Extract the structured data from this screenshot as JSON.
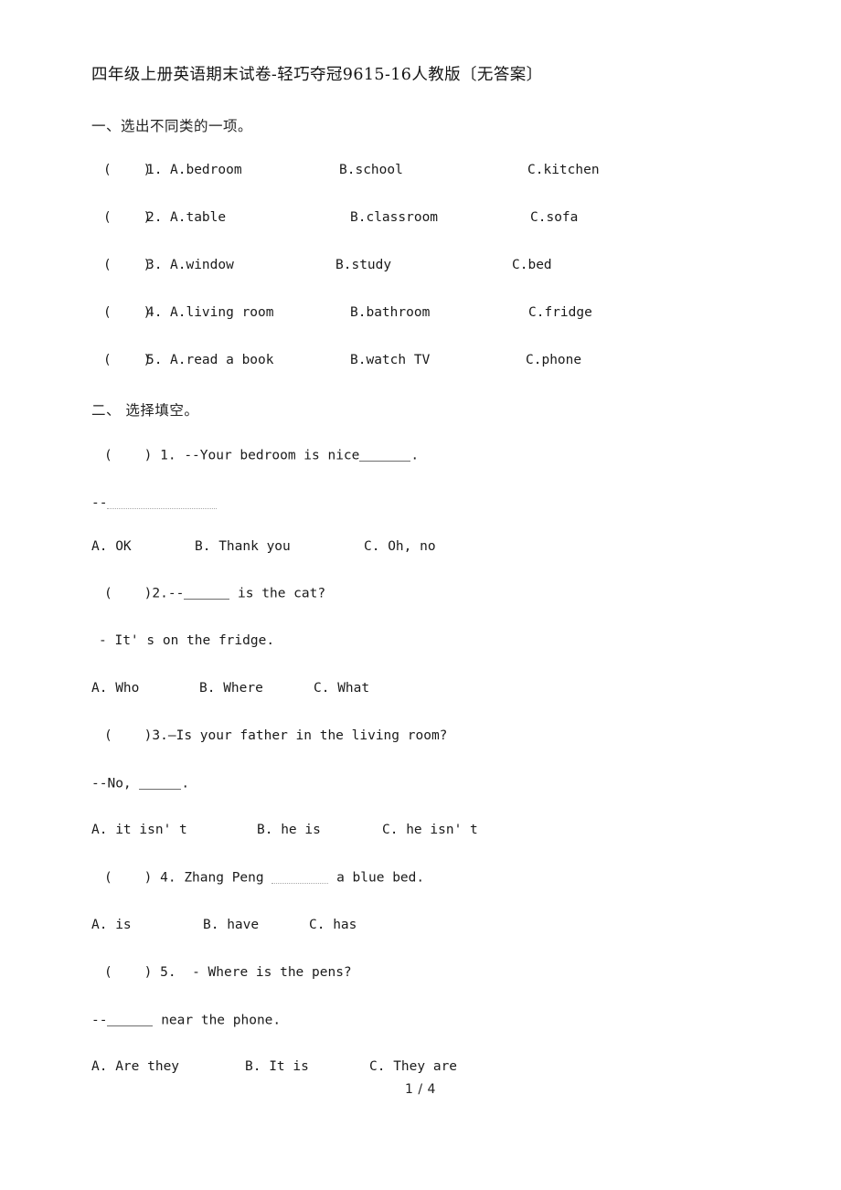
{
  "document": {
    "title": "四年级上册英语期末试卷-轻巧夺冠9615-16人教版〔无答案〕",
    "page_number": "1 / 4"
  },
  "sections": [
    {
      "heading": "一、选出不同类的一项。",
      "type": "multiple-choice-odd-one-out",
      "questions": [
        {
          "bracket": "(    )",
          "number": "1.",
          "a": "A.bedroom",
          "b": "B.school",
          "c": "C.kitchen"
        },
        {
          "bracket": "(    )",
          "number": "2.",
          "a": "A.table",
          "b": "B.classroom",
          "c": "C.sofa"
        },
        {
          "bracket": "(    )",
          "number": "3.",
          "a": "A.window",
          "b": "B.study",
          "c": "C.bed"
        },
        {
          "bracket": "(    )",
          "number": "4.",
          "a": "A.living room",
          "b": "B.bathroom",
          "c": "C.fridge"
        },
        {
          "bracket": "(    )",
          "number": "5.",
          "a": "A.read a book",
          "b": "B.watch TV",
          "c": "C.phone"
        }
      ]
    },
    {
      "heading": "二、 选择填空。",
      "type": "multiple-choice-fill-in",
      "questions": [
        {
          "bracket": "(    )",
          "number": "1.",
          "stem_before": "--Your bedroom is nice",
          "stem_after": ".",
          "reply_before": "--",
          "reply_after": "",
          "a": "A. OK",
          "b": "B. Thank you",
          "c": "C. Oh, no"
        },
        {
          "bracket": "(    )",
          "number": "2.",
          "stem_before": "--",
          "stem_after": " is the cat?",
          "reply_before": "- It' s on the fridge.",
          "reply_after": "",
          "a": "A. Who",
          "b": "B. Where",
          "c": "C. What"
        },
        {
          "bracket": "(    )",
          "number": "3.",
          "stem_before": "—Is your father in the living room?",
          "stem_after": "",
          "reply_before": "--No, ",
          "reply_after": ".",
          "a": "A. it isn' t",
          "b": "B. he is",
          "c": "C. he isn' t"
        },
        {
          "bracket": "(    )",
          "number": "4.",
          "stem_before": "Zhang Peng ",
          "stem_after": " a blue bed.",
          "reply_before": "",
          "reply_after": "",
          "a": "A. is",
          "b": "B. have",
          "c": "C. has"
        },
        {
          "bracket": "(    )",
          "number": "5.",
          "stem_before": "- Where is the pens?",
          "stem_after": "",
          "reply_before": "--",
          "reply_after": " near the phone.",
          "a": "A. Are they",
          "b": "B. It is",
          "c": "C. They are"
        }
      ]
    }
  ]
}
